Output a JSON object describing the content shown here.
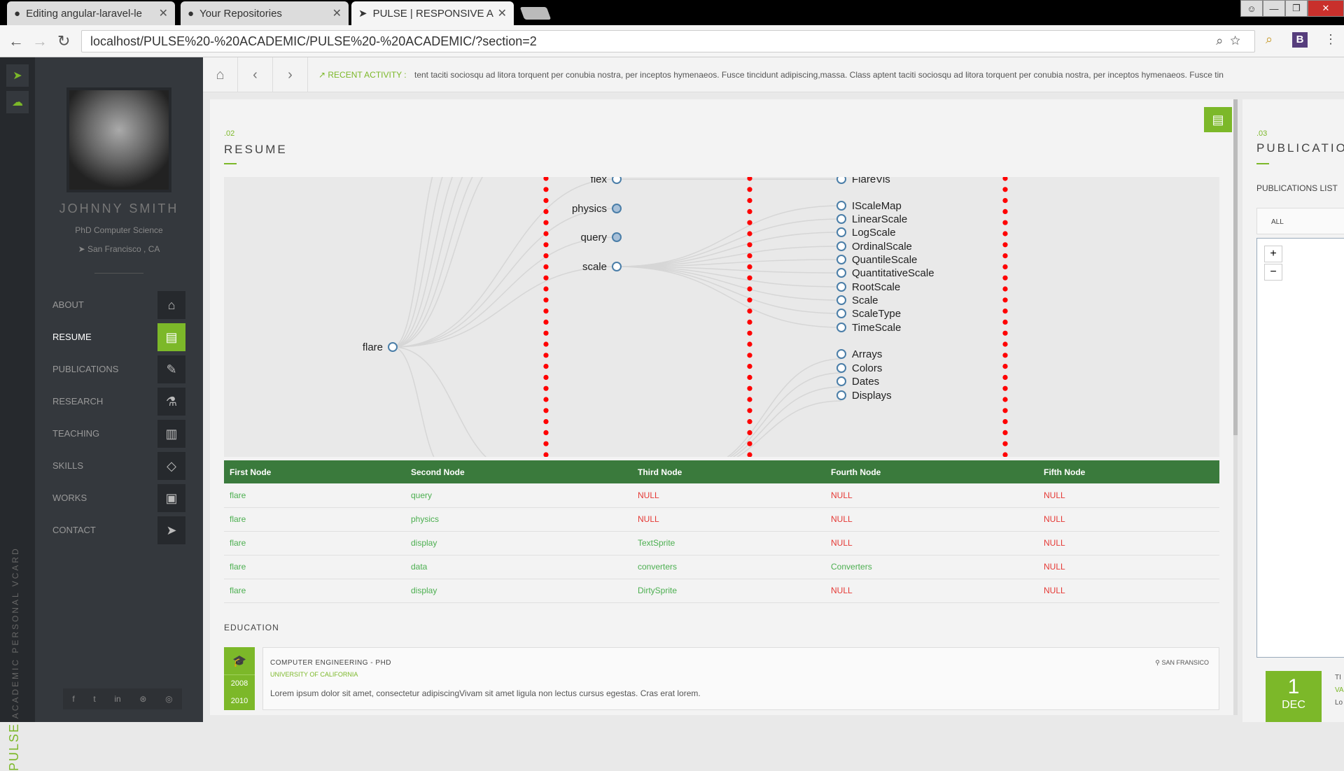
{
  "browser": {
    "tabs": [
      {
        "title": "Editing angular-laravel-le",
        "icon": "github-icon"
      },
      {
        "title": "Your Repositories",
        "icon": "github-icon"
      },
      {
        "title": "PULSE | RESPONSIVE AC",
        "icon": "cursor-icon"
      }
    ],
    "url": "localhost/PULSE%20-%20ACADEMIC/PULSE%20-%20ACADEMIC/?section=2",
    "extension_label": "B"
  },
  "brand": {
    "word": "PULSE",
    "rest": " ACADEMIC PERSONAL VCARD"
  },
  "profile": {
    "name": "JOHNNY SMITH",
    "degree": "PhD Computer Science",
    "location": "San Francisco , CA"
  },
  "menu": [
    {
      "label": "ABOUT",
      "icon": "home-icon",
      "active": false
    },
    {
      "label": "RESUME",
      "icon": "resume-icon",
      "active": true
    },
    {
      "label": "PUBLICATIONS",
      "icon": "pencil-icon",
      "active": false
    },
    {
      "label": "RESEARCH",
      "icon": "flask-icon",
      "active": false
    },
    {
      "label": "TEACHING",
      "icon": "book-icon",
      "active": false
    },
    {
      "label": "SKILLS",
      "icon": "diamond-icon",
      "active": false
    },
    {
      "label": "WORKS",
      "icon": "archive-icon",
      "active": false
    },
    {
      "label": "CONTACT",
      "icon": "paper-plane-icon",
      "active": false
    }
  ],
  "social": [
    "facebook-icon",
    "twitter-icon",
    "linkedin-icon",
    "dribbble-icon",
    "github-icon"
  ],
  "topbar": {
    "recent_label": "RECENT ACTIVITY :",
    "recent_text": "tent taciti sociosqu ad litora torquent per conubia nostra, per inceptos hymenaeos. Fusce tincidunt adipiscing,massa. Class aptent taciti sociosqu ad litora torquent per conubia nostra, per inceptos hymenaeos. Fusce tin"
  },
  "resume": {
    "number": ".02",
    "title": "RESUME",
    "tree": {
      "root": "flare",
      "level2": [
        "flex",
        "physics",
        "query",
        "scale"
      ],
      "level3_upper": [
        "FlareVis",
        "IScaleMap",
        "LinearScale",
        "LogScale",
        "OrdinalScale",
        "QuantileScale",
        "QuantitativeScale",
        "RootScale",
        "Scale",
        "ScaleType",
        "TimeScale"
      ],
      "level3_lower": [
        "Arrays",
        "Colors",
        "Dates",
        "Displays"
      ]
    },
    "table": {
      "headers": [
        "First Node",
        "Second Node",
        "Third Node",
        "Fourth Node",
        "Fifth Node"
      ],
      "rows": [
        [
          "flare",
          "query",
          "NULL",
          "NULL",
          "NULL"
        ],
        [
          "flare",
          "physics",
          "NULL",
          "NULL",
          "NULL"
        ],
        [
          "flare",
          "display",
          "TextSprite",
          "NULL",
          "NULL"
        ],
        [
          "flare",
          "data",
          "converters",
          "Converters",
          "NULL"
        ],
        [
          "flare",
          "display",
          "DirtySprite",
          "NULL",
          "NULL"
        ]
      ]
    },
    "education": {
      "heading": "EDUCATION",
      "years": [
        "2008",
        "2010"
      ],
      "title": "COMPUTER ENGINEERING - PHD",
      "university": "UNIVERSITY OF CALIFORNIA",
      "location": "SAN FRANSICO",
      "description": "Lorem ipsum dolor sit amet, consectetur adipiscingVivam sit amet ligula non lectus cursus egestas. Cras erat lorem."
    }
  },
  "publications": {
    "number": ".03",
    "title": "PUBLICATIO",
    "list_label": "PUBLICATIONS LIST",
    "filter": "ALL",
    "zoom_in": "+",
    "zoom_out": "−",
    "date_day": "1",
    "date_month": "DEC",
    "side_lines": [
      "TI",
      "VA",
      "Lo"
    ]
  },
  "colors": {
    "accent": "#7cb829",
    "table_header": "#3a7a3c",
    "null": "#e53935",
    "sidebar": "#34383d"
  }
}
